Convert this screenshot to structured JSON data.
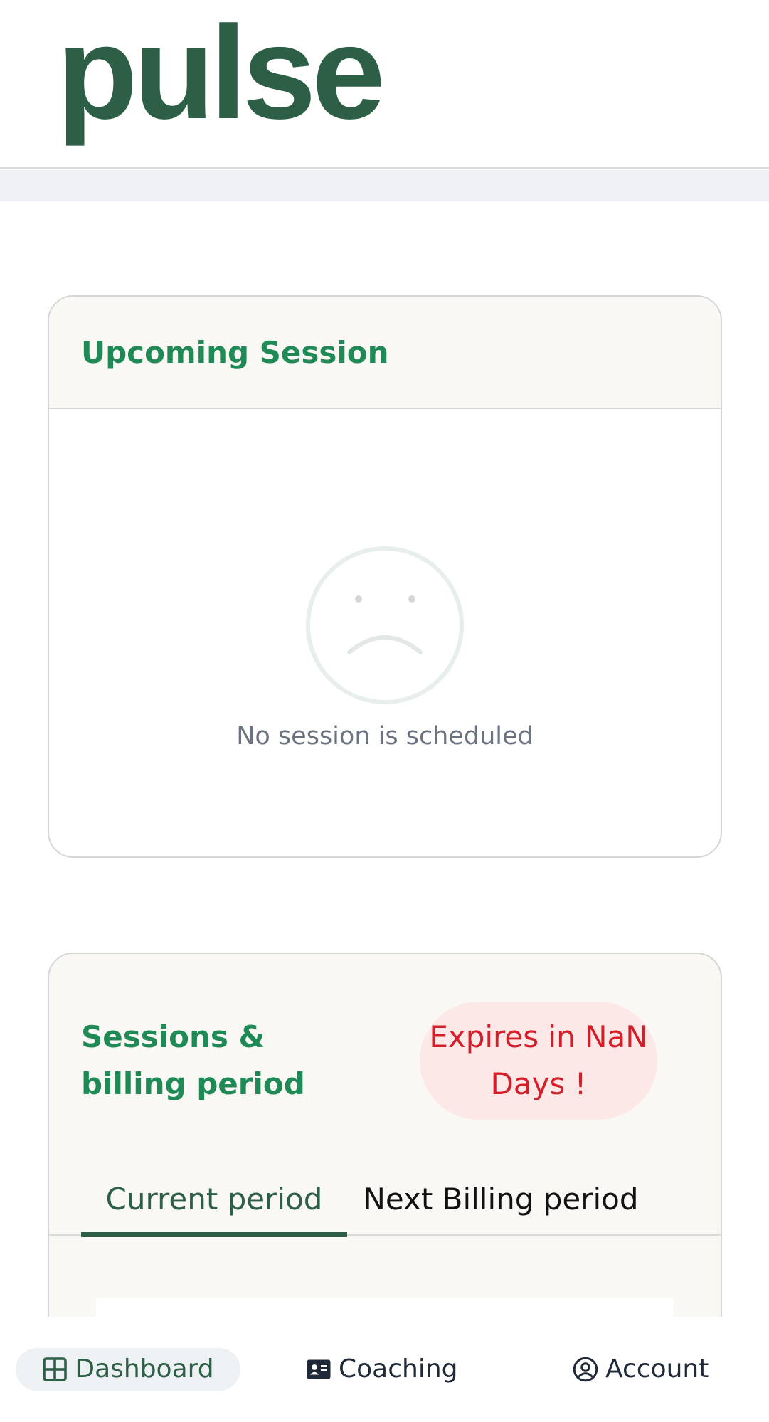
{
  "app": {
    "logo_text": "pulse"
  },
  "colors": {
    "brand_green": "#2c5f45",
    "title_green": "#1f8a55",
    "expire_red": "#d41f2a",
    "expire_bg": "#fde8e8",
    "muted_text": "#6b7280",
    "active_nav_bg": "#eef1f4"
  },
  "upcoming_session": {
    "title": "Upcoming Session",
    "empty_icon": "sad-face-icon",
    "empty_message": "No session is scheduled"
  },
  "billing": {
    "title": "Sessions & billing period",
    "expires_badge": "Expires in NaN Days !",
    "tabs": [
      {
        "label": "Current period",
        "active": true
      },
      {
        "label": "Next Billing period",
        "active": false
      }
    ]
  },
  "bottom_nav": {
    "items": [
      {
        "label": "Dashboard",
        "icon": "grid-icon",
        "active": true
      },
      {
        "label": "Coaching",
        "icon": "id-card-icon",
        "active": false
      },
      {
        "label": "Account",
        "icon": "user-circle-icon",
        "active": false
      }
    ]
  }
}
